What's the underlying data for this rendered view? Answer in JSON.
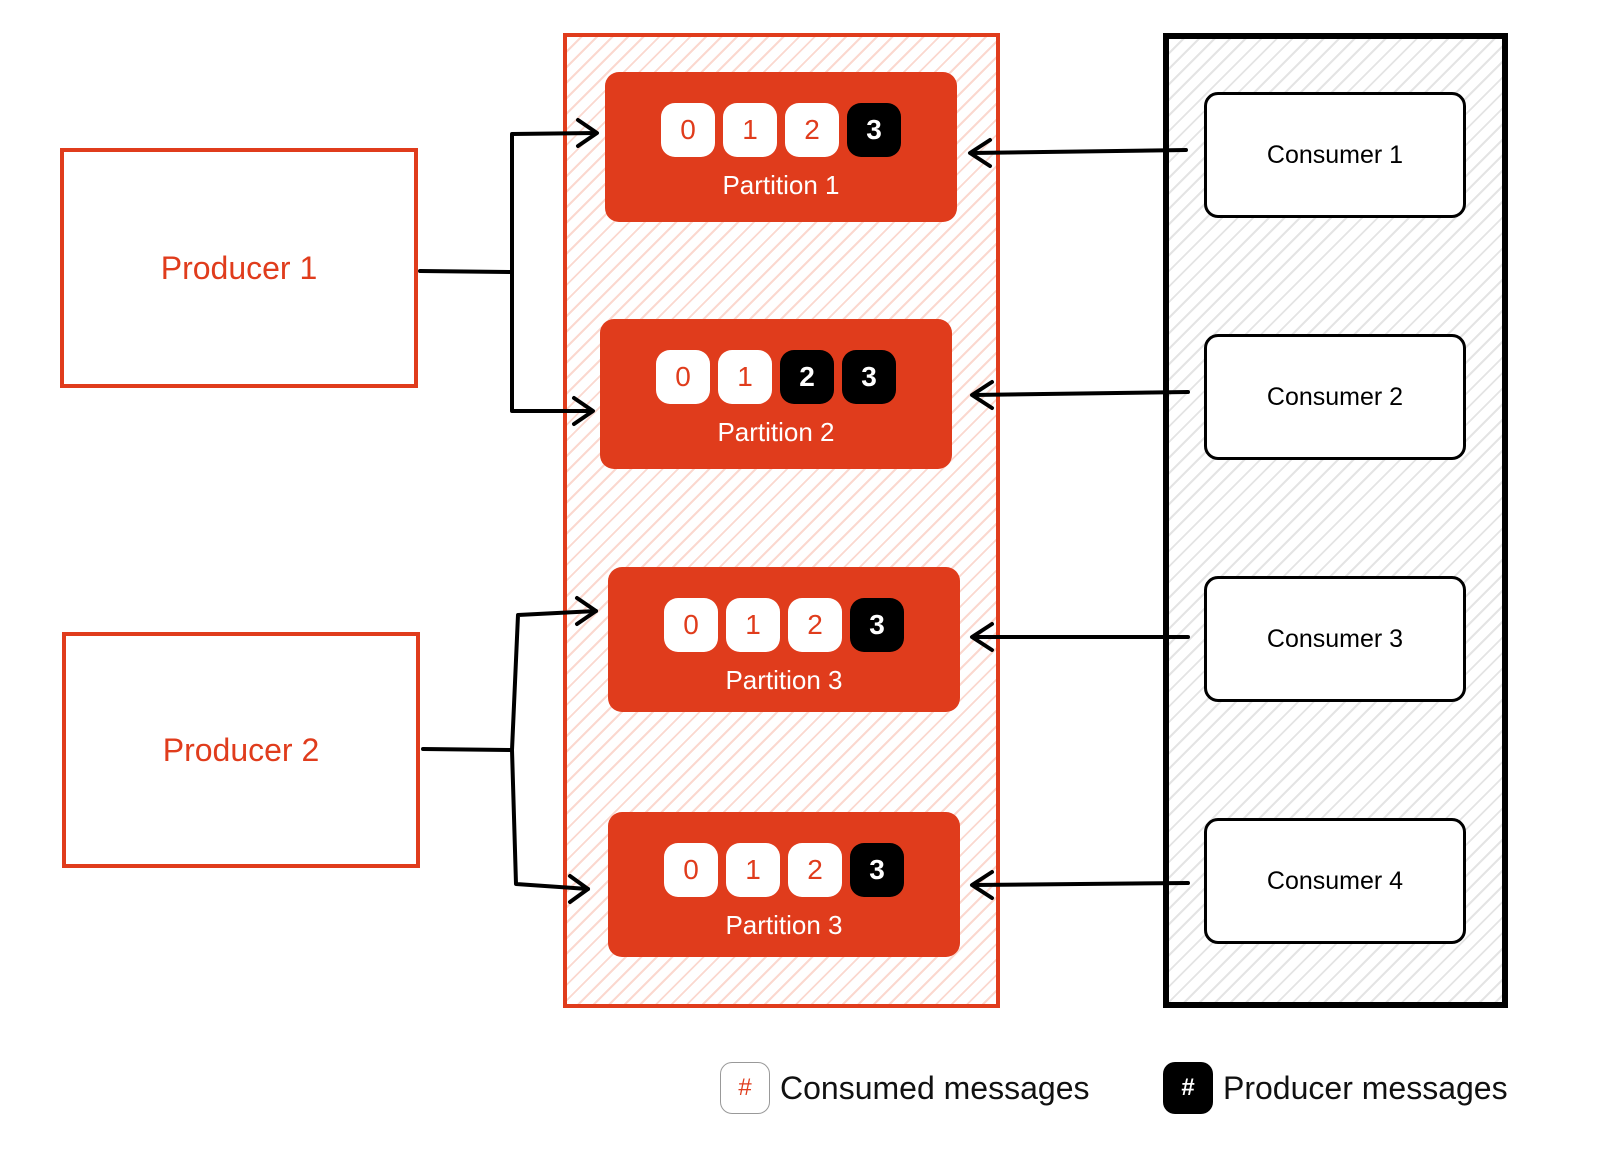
{
  "producers": [
    {
      "label": "Producer 1"
    },
    {
      "label": "Producer 2"
    }
  ],
  "partitions": [
    {
      "label": "Partition 1",
      "cells": [
        {
          "value": "0",
          "state": "consumed"
        },
        {
          "value": "1",
          "state": "consumed"
        },
        {
          "value": "2",
          "state": "consumed"
        },
        {
          "value": "3",
          "state": "produced"
        }
      ]
    },
    {
      "label": "Partition 2",
      "cells": [
        {
          "value": "0",
          "state": "consumed"
        },
        {
          "value": "1",
          "state": "consumed"
        },
        {
          "value": "2",
          "state": "produced"
        },
        {
          "value": "3",
          "state": "produced"
        }
      ]
    },
    {
      "label": "Partition 3",
      "cells": [
        {
          "value": "0",
          "state": "consumed"
        },
        {
          "value": "1",
          "state": "consumed"
        },
        {
          "value": "2",
          "state": "consumed"
        },
        {
          "value": "3",
          "state": "produced"
        }
      ]
    },
    {
      "label": "Partition 3",
      "cells": [
        {
          "value": "0",
          "state": "consumed"
        },
        {
          "value": "1",
          "state": "consumed"
        },
        {
          "value": "2",
          "state": "consumed"
        },
        {
          "value": "3",
          "state": "produced"
        }
      ]
    }
  ],
  "consumers": [
    {
      "label": "Consumer 1"
    },
    {
      "label": "Consumer 2"
    },
    {
      "label": "Consumer 3"
    },
    {
      "label": "Consumer 4"
    }
  ],
  "legend": {
    "consumed": {
      "symbol": "#",
      "label": "Consumed messages"
    },
    "produced": {
      "symbol": "#",
      "label": "Producer messages"
    }
  },
  "colors": {
    "accent": "#e03c1c",
    "dark": "#000000",
    "white": "#ffffff"
  }
}
